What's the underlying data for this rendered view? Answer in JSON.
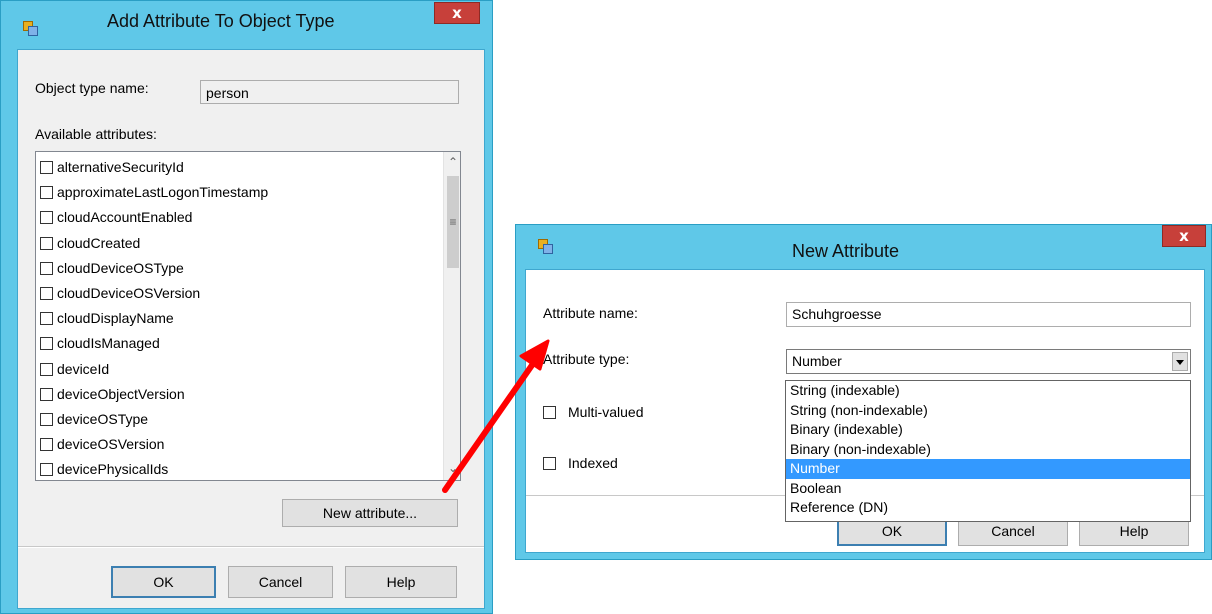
{
  "dialog1": {
    "title": "Add Attribute To Object Type",
    "close": "x",
    "object_type_label": "Object type name:",
    "object_type_value": "person",
    "available_label": "Available attributes:",
    "attributes": [
      {
        "name": "alternativeSecurityId",
        "checked": false
      },
      {
        "name": "approximateLastLogonTimestamp",
        "checked": false
      },
      {
        "name": "cloudAccountEnabled",
        "checked": false
      },
      {
        "name": "cloudCreated",
        "checked": false
      },
      {
        "name": "cloudDeviceOSType",
        "checked": false
      },
      {
        "name": "cloudDeviceOSVersion",
        "checked": false
      },
      {
        "name": "cloudDisplayName",
        "checked": false
      },
      {
        "name": "cloudIsManaged",
        "checked": false
      },
      {
        "name": "deviceId",
        "checked": false
      },
      {
        "name": "deviceObjectVersion",
        "checked": false
      },
      {
        "name": "deviceOSType",
        "checked": false
      },
      {
        "name": "deviceOSVersion",
        "checked": false
      },
      {
        "name": "devicePhysicalIds",
        "checked": false
      }
    ],
    "new_attribute_button": "New attribute...",
    "ok_button": "OK",
    "cancel_button": "Cancel",
    "help_button": "Help"
  },
  "dialog2": {
    "title": "New Attribute",
    "close": "x",
    "attr_name_label": "Attribute name:",
    "attr_name_value": "Schuhgroesse",
    "attr_type_label": "Attribute type:",
    "attr_type_value": "Number",
    "type_options": [
      "String (indexable)",
      "String (non-indexable)",
      "Binary (indexable)",
      "Binary (non-indexable)",
      "Number",
      "Boolean",
      "Reference (DN)"
    ],
    "selected_option": "Number",
    "multi_valued_label": "Multi-valued",
    "multi_valued_checked": false,
    "indexed_label": "Indexed",
    "indexed_checked": false,
    "ok_button": "OK",
    "cancel_button": "Cancel",
    "help_button": "Help"
  },
  "colors": {
    "frame": "#5fc8e8",
    "close": "#c7403a",
    "selection": "#3399ff",
    "arrow": "#ff0000"
  }
}
